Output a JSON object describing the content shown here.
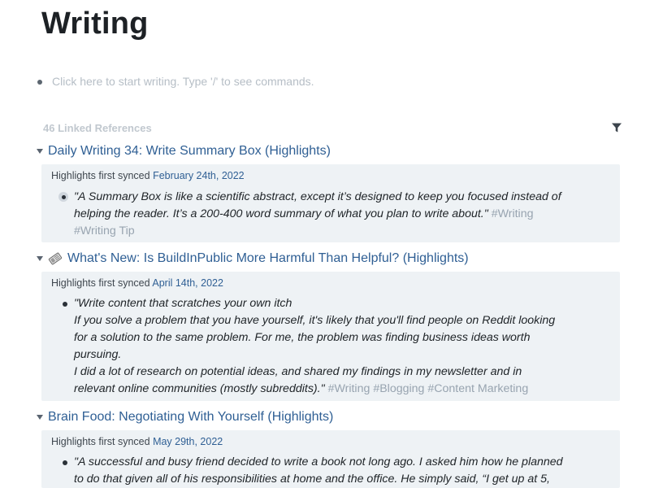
{
  "page": {
    "title": "Writing",
    "placeholder": "Click here to start writing. Type '/' to see commands."
  },
  "linked_references": {
    "count_label": "46 Linked References",
    "items": [
      {
        "title": "Daily Writing 34: Write Summary Box (Highlights)",
        "synced_prefix": "Highlights first synced",
        "synced_date": "February 24th, 2022",
        "lines": [
          "\"A Summary Box is like a scientific abstract, except it’s designed to keep you focused instead of",
          "helping the reader. It’s a 200-400 word summary of what you plan to write about.\""
        ],
        "tags": [
          "#Writing",
          "#Writing Tip"
        ]
      },
      {
        "title": "What's New: Is BuildInPublic More Harmful Than Helpful? (Highlights)",
        "icon": "newspaper-icon",
        "synced_prefix": "Highlights first synced",
        "synced_date": "April 14th, 2022",
        "lines": [
          "\"Write content that scratches your own itch",
          "If you solve a problem that you have yourself, it's likely that you'll find people on Reddit looking",
          "for a solution to the same problem. For me, the problem was finding business ideas worth",
          "pursuing.",
          "I did a lot of research on potential ideas, and shared my findings in my newsletter and in",
          "relevant online communities (mostly subreddits).\""
        ],
        "tags": [
          "#Writing",
          "#Blogging",
          "#Content Marketing"
        ]
      },
      {
        "title": "Brain Food: Negotiating With Yourself (Highlights)",
        "synced_prefix": "Highlights first synced",
        "synced_date": "May 29th, 2022",
        "lines": [
          "\"A successful and busy friend decided to write a book not long ago. I asked him how he planned",
          "to do that given all of his responsibilities at home and the office. He simply said, “I get up at 5,"
        ]
      }
    ]
  },
  "icons": {
    "filter": "filter-icon",
    "caret": "caret-down-icon"
  },
  "colors": {
    "link": "#2f5f94",
    "tag": "#98a4b0",
    "card_bg": "#eef2f5"
  }
}
